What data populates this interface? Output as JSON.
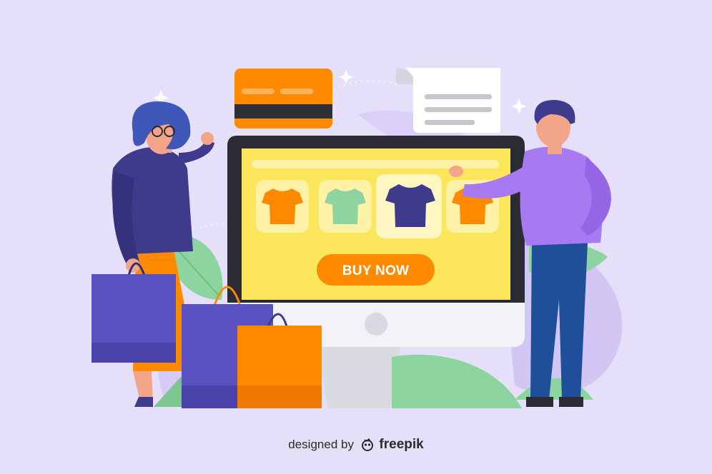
{
  "illustration": {
    "cta_label": "BUY NOW",
    "credit_prefix": "designed by",
    "credit_brand": "freepik"
  },
  "colors": {
    "background": "#e6dffa",
    "screen": "#fbe55a",
    "accent_orange": "#ff8a00",
    "navy": "#3e3a8c",
    "purple_shirt": "#a77af2",
    "mint": "#8ed4a0"
  },
  "icons": [
    "credit-card",
    "receipt",
    "t-shirt",
    "shopping-bag",
    "sparkle"
  ]
}
